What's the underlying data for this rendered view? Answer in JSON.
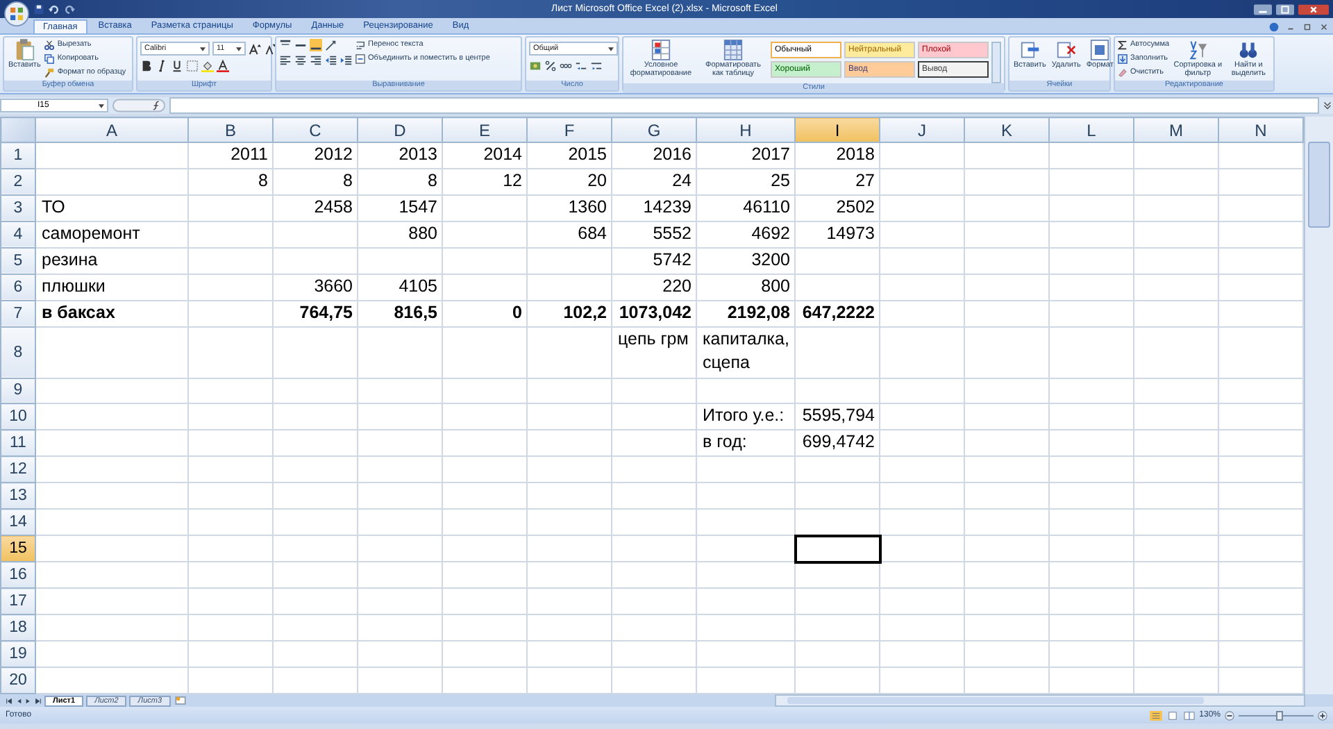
{
  "window": {
    "title": "Лист Microsoft Office Excel (2).xlsx - Microsoft Excel"
  },
  "tabs": [
    {
      "label": "Главная",
      "selected": true
    },
    {
      "label": "Вставка",
      "selected": false
    },
    {
      "label": "Разметка страницы",
      "selected": false
    },
    {
      "label": "Формулы",
      "selected": false
    },
    {
      "label": "Данные",
      "selected": false
    },
    {
      "label": "Рецензирование",
      "selected": false
    },
    {
      "label": "Вид",
      "selected": false
    }
  ],
  "ribbon": {
    "clipboard": {
      "label": "Буфер обмена",
      "paste": "Вставить",
      "cut": "Вырезать",
      "copy": "Копировать",
      "format_painter": "Формат по образцу"
    },
    "font": {
      "label": "Шрифт",
      "family": "Calibri",
      "size": "11"
    },
    "alignment": {
      "label": "Выравнивание",
      "wrap_text": "Перенос текста",
      "merge_center": "Объединить и поместить в центре"
    },
    "number": {
      "label": "Число",
      "format": "Общий"
    },
    "styles": {
      "label": "Стили",
      "conditional_formatting": "Условное форматирование",
      "format_as_table": "Форматировать как таблицу",
      "cell_styles": [
        {
          "label": "Обычный",
          "kind": "normal"
        },
        {
          "label": "Нейтральный",
          "kind": "neutral"
        },
        {
          "label": "Плохой",
          "kind": "bad"
        },
        {
          "label": "Хороший",
          "kind": "good"
        },
        {
          "label": "Ввод",
          "kind": "input"
        },
        {
          "label": "Вывод",
          "kind": "output"
        }
      ]
    },
    "cells": {
      "label": "Ячейки",
      "insert": "Вставить",
      "delete": "Удалить",
      "format": "Формат"
    },
    "editing": {
      "label": "Редактирование",
      "autosum": "Автосумма",
      "fill": "Заполнить",
      "clear": "Очистить",
      "sort_filter": "Сортировка и фильтр",
      "find_select": "Найти и выделить"
    }
  },
  "formula_bar": {
    "name_box": "I15"
  },
  "columns": [
    {
      "label": "A",
      "selected": false
    },
    {
      "label": "B",
      "selected": false
    },
    {
      "label": "C",
      "selected": false
    },
    {
      "label": "D",
      "selected": false
    },
    {
      "label": "E",
      "selected": false
    },
    {
      "label": "F",
      "selected": false
    },
    {
      "label": "G",
      "selected": false
    },
    {
      "label": "H",
      "selected": false
    },
    {
      "label": "I",
      "selected": true
    },
    {
      "label": "J",
      "selected": false
    },
    {
      "label": "K",
      "selected": false
    },
    {
      "label": "L",
      "selected": false
    },
    {
      "label": "M",
      "selected": false
    },
    {
      "label": "N",
      "selected": false
    }
  ],
  "rows": [
    {
      "number": "1",
      "selected": false,
      "bold": false,
      "cells": {
        "B": {
          "value": "2011",
          "kind": "number"
        },
        "C": {
          "value": "2012",
          "kind": "number"
        },
        "D": {
          "value": "2013",
          "kind": "number"
        },
        "E": {
          "value": "2014",
          "kind": "number"
        },
        "F": {
          "value": "2015",
          "kind": "number"
        },
        "G": {
          "value": "2016",
          "kind": "number"
        },
        "H": {
          "value": "2017",
          "kind": "number"
        },
        "I": {
          "value": "2018",
          "kind": "number"
        }
      }
    },
    {
      "number": "2",
      "selected": false,
      "bold": false,
      "cells": {
        "B": {
          "value": "8",
          "kind": "number"
        },
        "C": {
          "value": "8",
          "kind": "number"
        },
        "D": {
          "value": "8",
          "kind": "number"
        },
        "E": {
          "value": "12",
          "kind": "number"
        },
        "F": {
          "value": "20",
          "kind": "number"
        },
        "G": {
          "value": "24",
          "kind": "number"
        },
        "H": {
          "value": "25",
          "kind": "number"
        },
        "I": {
          "value": "27",
          "kind": "number"
        }
      }
    },
    {
      "number": "3",
      "selected": false,
      "bold": false,
      "cells": {
        "A": {
          "value": "ТО",
          "kind": "text"
        },
        "C": {
          "value": "2458",
          "kind": "number"
        },
        "D": {
          "value": "1547",
          "kind": "number"
        },
        "F": {
          "value": "1360",
          "kind": "number"
        },
        "G": {
          "value": "14239",
          "kind": "number"
        },
        "H": {
          "value": "46110",
          "kind": "number"
        },
        "I": {
          "value": "2502",
          "kind": "number"
        }
      }
    },
    {
      "number": "4",
      "selected": false,
      "bold": false,
      "cells": {
        "A": {
          "value": "саморемонт",
          "kind": "text"
        },
        "D": {
          "value": "880",
          "kind": "number"
        },
        "F": {
          "value": "684",
          "kind": "number"
        },
        "G": {
          "value": "5552",
          "kind": "number"
        },
        "H": {
          "value": "4692",
          "kind": "number"
        },
        "I": {
          "value": "14973",
          "kind": "number"
        }
      }
    },
    {
      "number": "5",
      "selected": false,
      "bold": false,
      "cells": {
        "A": {
          "value": "резина",
          "kind": "text"
        },
        "G": {
          "value": "5742",
          "kind": "number"
        },
        "H": {
          "value": "3200",
          "kind": "number"
        }
      }
    },
    {
      "number": "6",
      "selected": false,
      "bold": false,
      "cells": {
        "A": {
          "value": "плюшки",
          "kind": "text"
        },
        "C": {
          "value": "3660",
          "kind": "number"
        },
        "D": {
          "value": "4105",
          "kind": "number"
        },
        "G": {
          "value": "220",
          "kind": "number"
        },
        "H": {
          "value": "800",
          "kind": "number"
        }
      }
    },
    {
      "number": "7",
      "selected": false,
      "bold": true,
      "cells": {
        "A": {
          "value": "в баксах",
          "kind": "text"
        },
        "C": {
          "value": "764,75",
          "kind": "number"
        },
        "D": {
          "value": "816,5",
          "kind": "number"
        },
        "E": {
          "value": "0",
          "kind": "number"
        },
        "F": {
          "value": "102,2",
          "kind": "number"
        },
        "G": {
          "value": "1073,042",
          "kind": "number"
        },
        "H": {
          "value": "2192,08",
          "kind": "number"
        },
        "I": {
          "value": "647,2222",
          "kind": "number"
        }
      }
    },
    {
      "number": "8",
      "selected": false,
      "bold": false,
      "cells": {
        "G": {
          "value": "цепь грм",
          "kind": "text"
        },
        "H": {
          "value": "капиталка, сцепа",
          "kind": "text"
        }
      }
    },
    {
      "number": "9",
      "selected": false,
      "cells": {}
    },
    {
      "number": "10",
      "selected": false,
      "bold": false,
      "cells": {
        "H": {
          "value": "Итого у.е.:",
          "kind": "text"
        },
        "I": {
          "value": "5595,794",
          "kind": "number"
        }
      }
    },
    {
      "number": "11",
      "selected": false,
      "bold": false,
      "cells": {
        "H": {
          "value": "в год:",
          "kind": "text"
        },
        "I": {
          "value": "699,4742",
          "kind": "number"
        }
      }
    },
    {
      "number": "12",
      "selected": false,
      "cells": {}
    },
    {
      "number": "13",
      "selected": false,
      "cells": {}
    },
    {
      "number": "14",
      "selected": false,
      "cells": {}
    },
    {
      "number": "15",
      "selected": true,
      "cells": {}
    },
    {
      "number": "16",
      "selected": false,
      "cells": {}
    },
    {
      "number": "17",
      "selected": false,
      "cells": {}
    },
    {
      "number": "18",
      "selected": false,
      "cells": {}
    },
    {
      "number": "19",
      "selected": false,
      "cells": {}
    },
    {
      "number": "20",
      "selected": false,
      "cells": {}
    }
  ],
  "sheet_tabs": [
    {
      "label": "Лист1",
      "selected": true
    },
    {
      "label": "Лист2",
      "selected": false
    },
    {
      "label": "Лист3",
      "selected": false
    }
  ],
  "status_bar": {
    "status": "Готово",
    "zoom": "130%",
    "zoom_slider": {
      "level": 0.55
    }
  }
}
